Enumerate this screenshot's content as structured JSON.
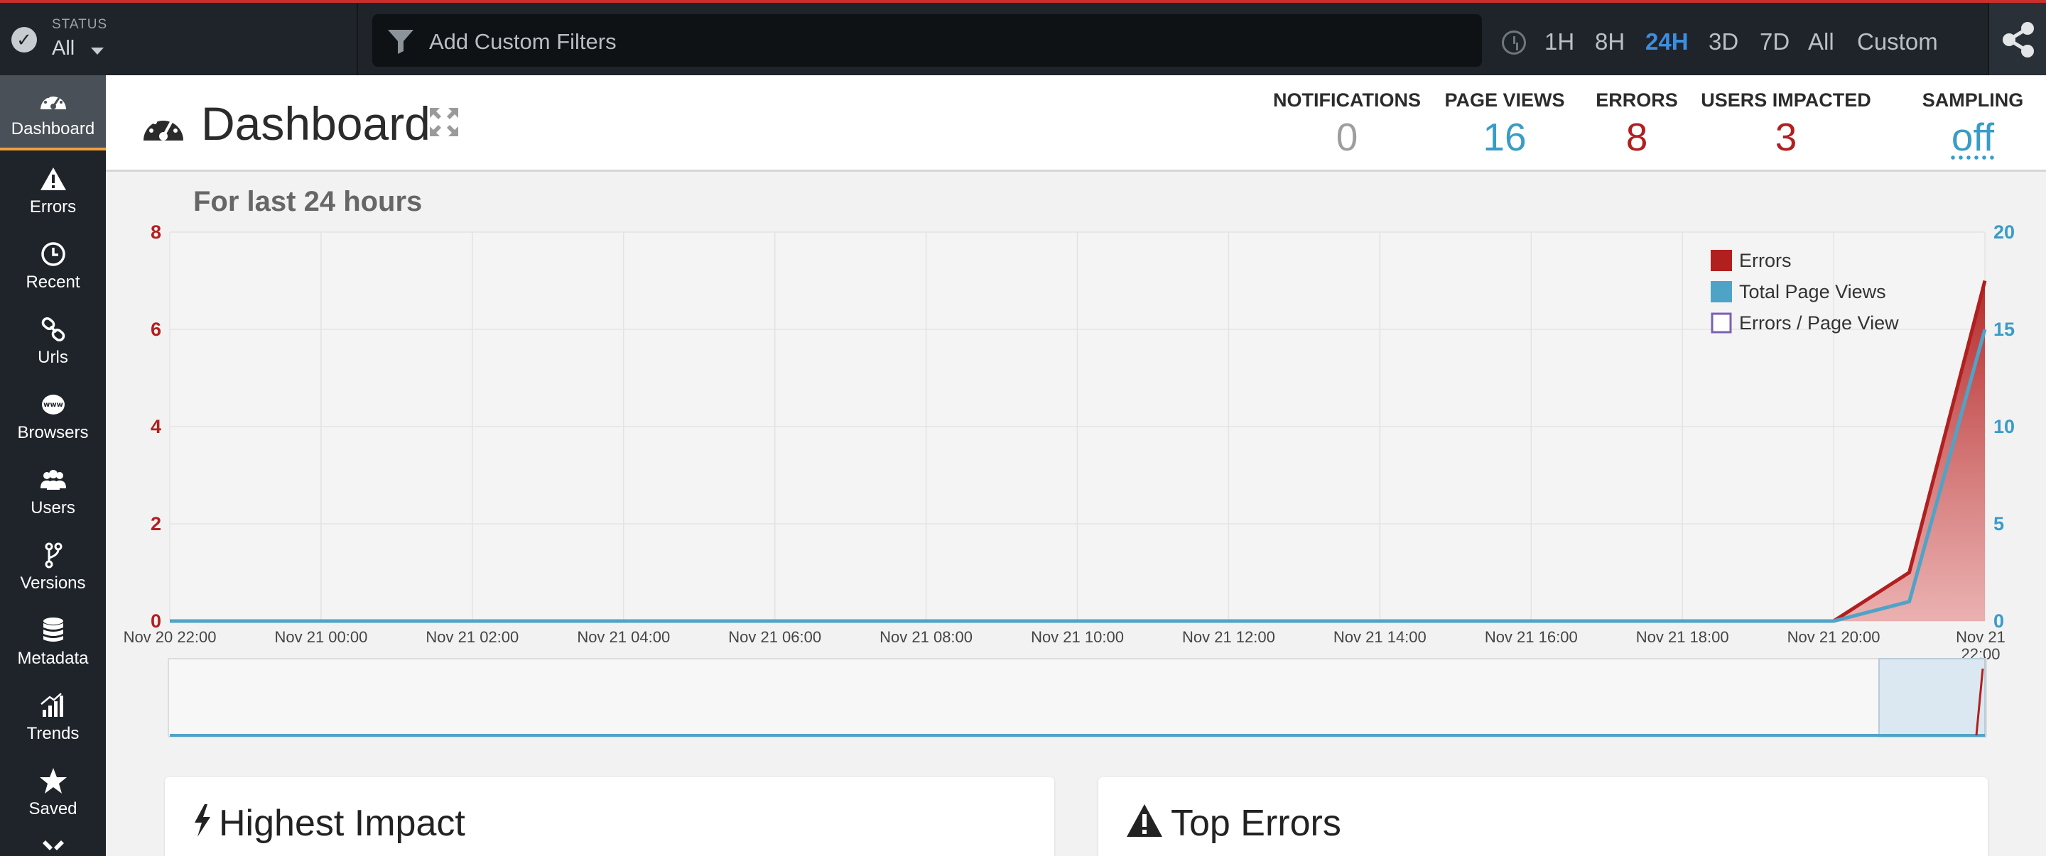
{
  "topbar": {
    "status_label": "STATUS",
    "status_value": "All",
    "filter_placeholder": "Add Custom Filters",
    "ranges": [
      "1H",
      "8H",
      "24H",
      "3D",
      "7D",
      "All",
      "Custom"
    ],
    "active_range": "24H"
  },
  "sidebar": {
    "items": [
      {
        "label": "Dashboard",
        "icon": "dashboard-icon"
      },
      {
        "label": "Errors",
        "icon": "warning-icon"
      },
      {
        "label": "Recent",
        "icon": "clock-icon"
      },
      {
        "label": "Urls",
        "icon": "link-icon"
      },
      {
        "label": "Browsers",
        "icon": "www-icon"
      },
      {
        "label": "Users",
        "icon": "users-icon"
      },
      {
        "label": "Versions",
        "icon": "branch-icon"
      },
      {
        "label": "Metadata",
        "icon": "database-icon"
      },
      {
        "label": "Trends",
        "icon": "trends-icon"
      },
      {
        "label": "Saved",
        "icon": "star-icon"
      }
    ]
  },
  "header": {
    "title": "Dashboard",
    "metrics": [
      {
        "label": "NOTIFICATIONS",
        "value": "0",
        "color": "#9e9e9e"
      },
      {
        "label": "PAGE VIEWS",
        "value": "16",
        "color": "#3a9cc6"
      },
      {
        "label": "ERRORS",
        "value": "8",
        "color": "#b21f1f"
      },
      {
        "label": "USERS IMPACTED",
        "value": "3",
        "color": "#b21f1f"
      },
      {
        "label": "SAMPLING",
        "value": "off",
        "color": "#3a9cc6"
      }
    ]
  },
  "chart_title": "For last 24 hours",
  "chart_data": {
    "type": "area",
    "x": [
      "Nov 20 22:00",
      "Nov 21 00:00",
      "Nov 21 02:00",
      "Nov 21 04:00",
      "Nov 21 06:00",
      "Nov 21 08:00",
      "Nov 21 10:00",
      "Nov 21 12:00",
      "Nov 21 14:00",
      "Nov 21 16:00",
      "Nov 21 18:00",
      "Nov 21 20:00",
      "Nov 21 21:00",
      "Nov 21 22:00"
    ],
    "x_tick_labels": [
      "Nov 20 22:00",
      "Nov 21 00:00",
      "Nov 21 02:00",
      "Nov 21 04:00",
      "Nov 21 06:00",
      "Nov 21 08:00",
      "Nov 21 10:00",
      "Nov 21 12:00",
      "Nov 21 14:00",
      "Nov 21 16:00",
      "Nov 21 18:00",
      "Nov 21 20:00",
      "Nov 21 22:00"
    ],
    "series": [
      {
        "name": "Errors",
        "axis": "left",
        "color": "#b21f1f",
        "values": [
          0,
          0,
          0,
          0,
          0,
          0,
          0,
          0,
          0,
          0,
          0,
          0,
          1,
          7
        ]
      },
      {
        "name": "Total Page Views",
        "axis": "right",
        "color": "#4fa3c7",
        "values": [
          0,
          0,
          0,
          0,
          0,
          0,
          0,
          0,
          0,
          0,
          0,
          0,
          1,
          15
        ]
      },
      {
        "name": "Errors / Page View",
        "axis": "left",
        "color": "#7b5fb5",
        "values": []
      }
    ],
    "y_left": {
      "range": [
        0,
        8
      ],
      "ticks": [
        0,
        2,
        4,
        6,
        8
      ],
      "color": "#b21f1f"
    },
    "y_right": {
      "range": [
        0,
        20
      ],
      "ticks": [
        0,
        5,
        10,
        15,
        20
      ],
      "color": "#3a9cc6"
    },
    "grid": true,
    "legend": "top-right"
  },
  "panels": [
    {
      "title": "Highest Impact",
      "icon": "bolt-icon"
    },
    {
      "title": "Top Errors",
      "icon": "warning-icon"
    }
  ]
}
